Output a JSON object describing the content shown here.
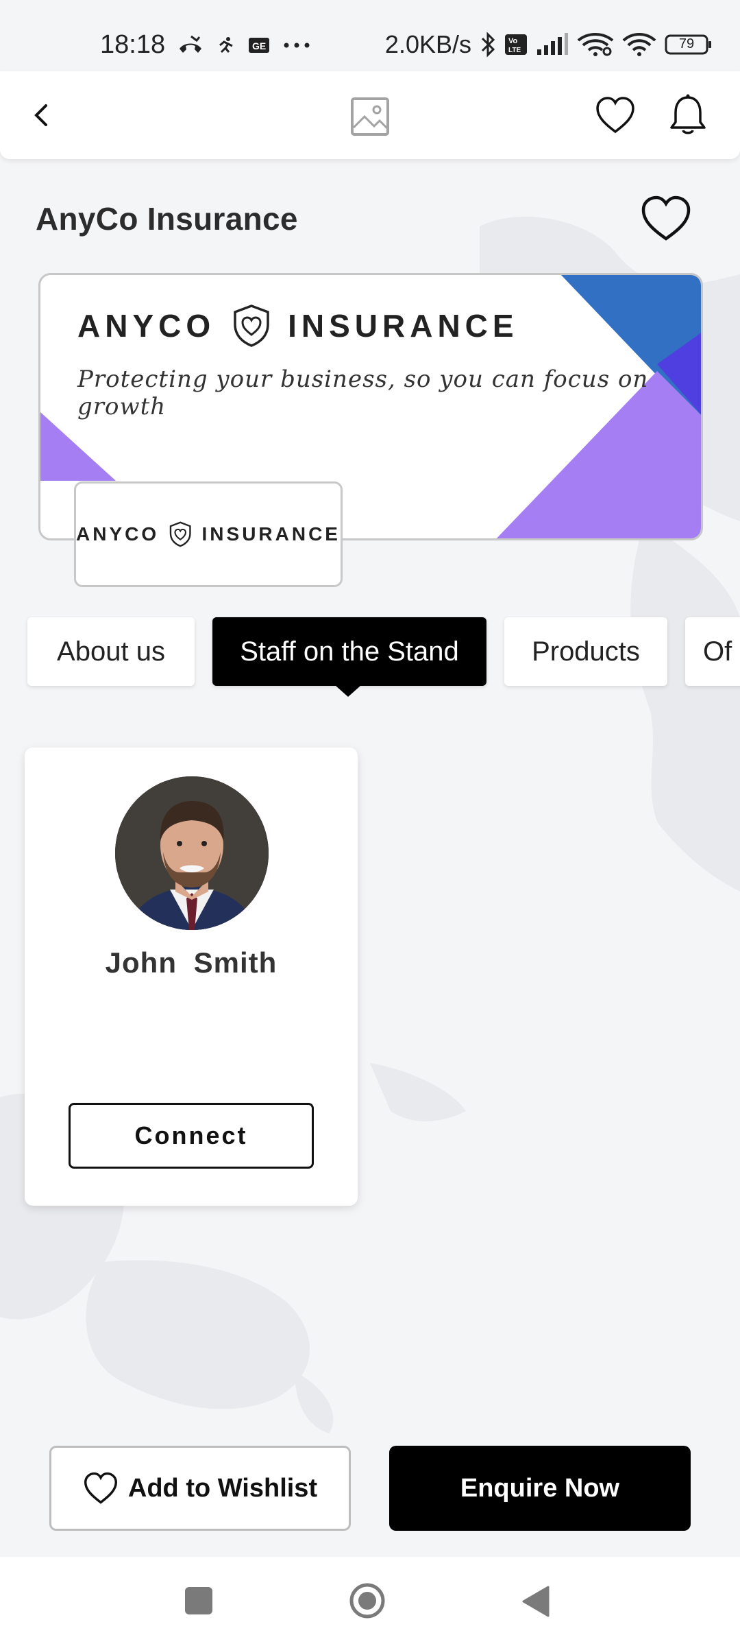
{
  "status_bar": {
    "time": "18:18",
    "network_speed": "2.0KB/s",
    "battery": "79",
    "icons": [
      "missed-call-icon",
      "running-icon",
      "sim-icon",
      "more-dots-icon",
      "bluetooth-icon",
      "volte-icon",
      "signal-icon",
      "wifi-link-icon",
      "wifi-icon",
      "battery-icon"
    ]
  },
  "top_bar": {
    "icons": [
      "back-icon",
      "image-placeholder-icon",
      "heart-icon",
      "bell-icon"
    ]
  },
  "exhibitor": {
    "title": "AnyCo Insurance"
  },
  "banner": {
    "brand_left": "ANYCO",
    "brand_right": "INSURANCE",
    "tagline": "Protecting your business, so you can focus on growth",
    "colors": {
      "blue": "#3270c4",
      "purple": "#a47ef2",
      "indigo": "#4f3fe0"
    }
  },
  "logo_card": {
    "brand_left": "ANYCO",
    "brand_right": "INSURANCE"
  },
  "tabs": [
    {
      "label": "About us"
    },
    {
      "label": "Staff on the Stand",
      "active": true
    },
    {
      "label": "Products"
    },
    {
      "label": "Of"
    }
  ],
  "staff": [
    {
      "first": "John",
      "last": "Smith",
      "name": "John Smith",
      "action": "Connect"
    }
  ],
  "actions": {
    "wishlist": "Add to Wishlist",
    "enquire": "Enquire Now"
  }
}
